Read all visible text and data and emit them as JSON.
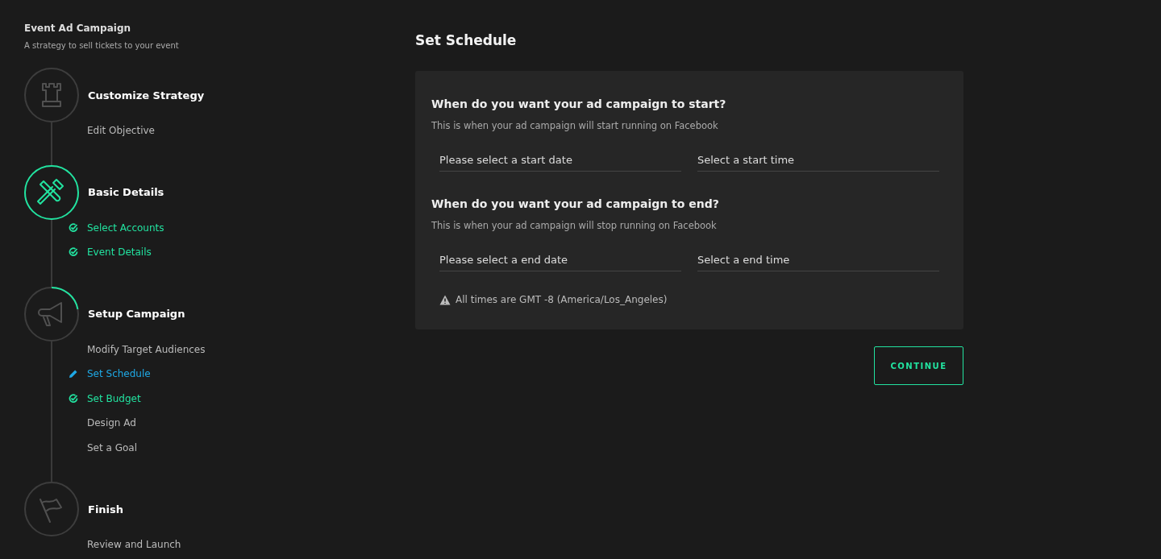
{
  "sidebar": {
    "title": "Event Ad Campaign",
    "subtitle": "A strategy to sell tickets to your event",
    "steps": [
      {
        "title": "Customize Strategy",
        "completed": false,
        "in_progress": false,
        "items": [
          {
            "label": "Edit Objective",
            "checked": false,
            "editing": false
          }
        ]
      },
      {
        "title": "Basic Details",
        "completed": true,
        "in_progress": false,
        "items": [
          {
            "label": "Select Accounts",
            "checked": true,
            "editing": false
          },
          {
            "label": "Event Details",
            "checked": true,
            "editing": false
          }
        ]
      },
      {
        "title": "Setup Campaign",
        "completed": false,
        "in_progress": true,
        "items": [
          {
            "label": "Modify Target Audiences",
            "checked": false,
            "editing": false
          },
          {
            "label": "Set Schedule",
            "checked": false,
            "editing": true
          },
          {
            "label": "Set Budget",
            "checked": true,
            "editing": false
          },
          {
            "label": "Design Ad",
            "checked": false,
            "editing": false
          },
          {
            "label": "Set a Goal",
            "checked": false,
            "editing": false
          }
        ]
      },
      {
        "title": "Finish",
        "completed": false,
        "in_progress": false,
        "items": [
          {
            "label": "Review and Launch",
            "checked": false,
            "editing": false
          }
        ]
      }
    ]
  },
  "main": {
    "title": "Set Schedule",
    "sections": [
      {
        "question": "When do you want your ad campaign to start?",
        "hint": "This is when your ad campaign will start running on Facebook",
        "fields": [
          {
            "placeholder": "Please select a start date"
          },
          {
            "placeholder": "Select a start time"
          }
        ]
      },
      {
        "question": "When do you want your ad campaign to end?",
        "hint": "This is when your ad campaign will stop running on Facebook",
        "fields": [
          {
            "placeholder": "Please select a end date"
          },
          {
            "placeholder": "Select a end time"
          }
        ]
      }
    ],
    "note": "All times are GMT -8 (America/Los_Angeles)",
    "button": "CONTINUE"
  }
}
